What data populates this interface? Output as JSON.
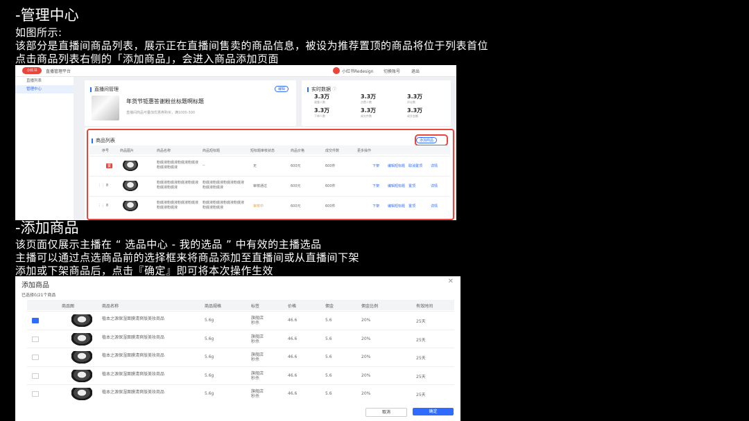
{
  "section1": {
    "heading": "-管理中心",
    "lines": [
      "如图所示:",
      "该部分是直播间商品列表，展示正在直播间售卖的商品信息，被设为推荐置顶的商品将位于列表首位",
      "点击商品列表右侧的「添加商品」，会进入商品添加页面"
    ]
  },
  "dashboard": {
    "logo": "小红书",
    "platform": "直播管理平台",
    "user": "小红书Redesign",
    "account_link": "切换账号",
    "logout": "退出",
    "sidebar": [
      "直播列表",
      "管理中心"
    ],
    "room_card": {
      "title": "直播间管理",
      "edit": "编辑",
      "live_title": "年货节钜惠答谢粉丝标题啊标题",
      "desc": "直播间商品可叠加优惠券购买，满1000-300"
    },
    "stats_card": {
      "title": "实时数据",
      "stats": [
        {
          "value": "3.3万",
          "label": "观看人数"
        },
        {
          "value": "3.3万",
          "label": "点赞人数"
        },
        {
          "value": "3.3万",
          "label": "评论数"
        },
        {
          "value": "3.3万",
          "label": "下单人数"
        },
        {
          "value": "3.3万",
          "label": "成交件数"
        },
        {
          "value": "3.3万",
          "label": "成交金额"
        }
      ]
    },
    "product_list": {
      "title": "商品列表",
      "add_button": "添加商品",
      "columns": [
        "序号",
        "商品图片",
        "商品名称",
        "商品短标题",
        "短标题审核状态",
        "商品价格",
        "成交件数",
        "更多操作"
      ],
      "rows": [
        {
          "index": "置",
          "name": "粉底液粉底液粉底液粉底液粉底液粉底液",
          "short": "--",
          "status": "无",
          "price": "600元",
          "sold": "600件",
          "ops": [
            "下架",
            "编辑短标题",
            "取消置顶",
            "详情"
          ]
        },
        {
          "index": "8",
          "name": "粉底液粉底液粉底液粉底液粉底液粉底液",
          "short": "粉底液粉底液粉底液粉底液粉底液粉底液",
          "status": "审核通过",
          "price": "600元",
          "sold": "600件",
          "ops": [
            "下架",
            "编辑短标题",
            "置顶",
            "详情"
          ]
        },
        {
          "index": "8",
          "name": "粉底液粉底液粉底液粉底液粉底液粉底液",
          "short": "粉底液粉底液粉底液粉底液粉底液粉底液",
          "status": "审核中",
          "price": "600元",
          "sold": "600件",
          "ops": [
            "下架",
            "编辑短标题",
            "置顶",
            "详情"
          ]
        }
      ]
    }
  },
  "section2": {
    "heading": "-添加商品",
    "lines": [
      "该页面仅展示主播在 “ 选品中心 - 我的选品 ” 中有效的主播选品",
      "主播可以通过点选商品前的选择框来将商品添加至直播间或从直播间下架",
      "添加或下架商品后，点击『确定』即可将本次操作生效"
    ]
  },
  "modal": {
    "title": "添加商品",
    "close": "✕",
    "selected": "已选择0/21个商品",
    "columns": [
      "商品图",
      "商品名称",
      "商品规格",
      "标签",
      "价格",
      "佣金",
      "佣金比例",
      "有效时间"
    ],
    "rows": [
      {
        "checked": true,
        "name": "植本之源保湿面膜清爽版美妆商品",
        "spec": "5.6g",
        "tag": "旗舰店秒杀",
        "price": "46.6",
        "commission": "5.6",
        "ratio": "20%",
        "valid": "25天"
      },
      {
        "checked": false,
        "name": "植本之源保湿面膜清爽版美妆商品",
        "spec": "5.6g",
        "tag": "旗舰店秒杀",
        "price": "46.6",
        "commission": "5.6",
        "ratio": "20%",
        "valid": "25天"
      },
      {
        "checked": false,
        "name": "植本之源保湿面膜清爽版美妆商品",
        "spec": "5.6g",
        "tag": "旗舰店秒杀",
        "price": "46.6",
        "commission": "5.6",
        "ratio": "20%",
        "valid": "25天"
      },
      {
        "checked": false,
        "name": "植本之源保湿面膜清爽版美妆商品",
        "spec": "5.6g",
        "tag": "旗舰店秒杀",
        "price": "46.6",
        "commission": "5.6",
        "ratio": "20%",
        "valid": "25天"
      },
      {
        "checked": false,
        "name": "植本之源保湿面膜清爽版美妆商品",
        "spec": "5.6g",
        "tag": "旗舰店秒杀",
        "price": "46.6",
        "commission": "5.6",
        "ratio": "20%",
        "valid": "25天"
      }
    ],
    "cancel": "取消",
    "confirm": "确定"
  }
}
